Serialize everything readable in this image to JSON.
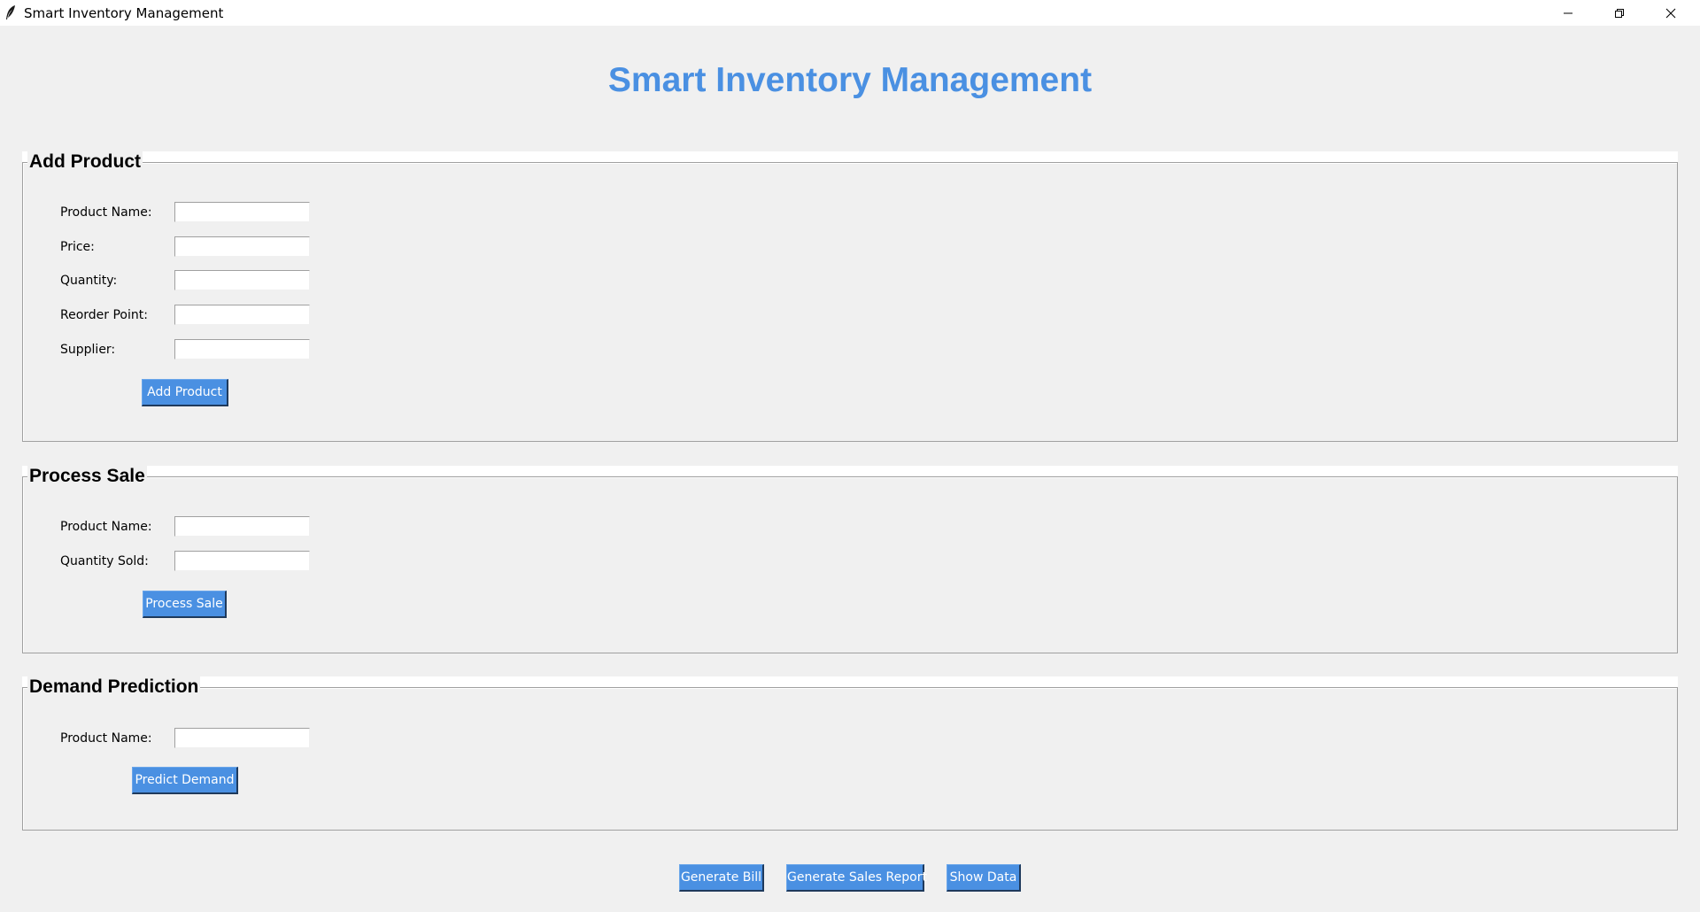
{
  "window": {
    "title": "Smart Inventory Management",
    "controls": {
      "minimize_icon": "minimize-icon",
      "maximize_icon": "restore-icon",
      "close_icon": "close-icon"
    }
  },
  "header": {
    "title": "Smart Inventory Management",
    "color": "#4a90e2"
  },
  "add_product": {
    "title": "Add Product",
    "fields": [
      {
        "label": "Product Name:",
        "value": ""
      },
      {
        "label": "Price:",
        "value": ""
      },
      {
        "label": "Quantity:",
        "value": ""
      },
      {
        "label": "Reorder Point:",
        "value": ""
      },
      {
        "label": "Supplier:",
        "value": ""
      }
    ],
    "button": "Add Product"
  },
  "process_sale": {
    "title": "Process Sale",
    "fields": [
      {
        "label": "Product Name:",
        "value": ""
      },
      {
        "label": "Quantity Sold:",
        "value": ""
      }
    ],
    "button": "Process Sale"
  },
  "demand_prediction": {
    "title": "Demand Prediction",
    "fields": [
      {
        "label": "Product Name:",
        "value": ""
      }
    ],
    "button": "Predict Demand"
  },
  "footer": {
    "buttons": [
      "Generate Bill",
      "Generate Sales Report",
      "Show Data"
    ]
  },
  "colors": {
    "accent": "#4a90e2",
    "background": "#f0f0f0"
  }
}
